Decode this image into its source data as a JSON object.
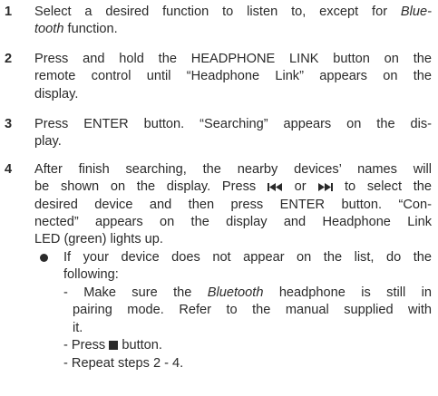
{
  "steps": [
    {
      "number": "1",
      "lines": [
        {
          "a": "Select a desired function to listen to, except for ",
          "i": "Blue-"
        },
        {
          "i": "tooth",
          "a": " function."
        }
      ]
    },
    {
      "number": "2",
      "lines": [
        "Press and hold the HEADPHONE LINK button on the",
        "remote control until “Headphone Link” appears on the",
        "display."
      ]
    },
    {
      "number": "3",
      "lines": [
        "Press ENTER button. “Searching” appears on the dis-",
        "play."
      ]
    },
    {
      "number": "4",
      "lines": [
        "After finish searching, the nearby devices’ names will",
        {
          "a": "be shown on the display. Press ",
          "or": " or ",
          "b": " to select the"
        },
        "desired device and then press ENTER button. “Con-",
        "nected” appears on the display and Headphone Link",
        "LED (green) lights up."
      ]
    }
  ],
  "bullet": {
    "lines": [
      "If your device does not appear on the list, do the",
      "following:"
    ]
  },
  "subitems": [
    {
      "lines": [
        {
          "a": "- Make sure the ",
          "i": "Bluetooth",
          "b": " headphone is still in"
        },
        "pairing mode. Refer to the manual supplied with",
        "it."
      ]
    },
    {
      "lines": [
        {
          "a": "- Press ",
          "b": " button."
        }
      ]
    },
    {
      "lines": [
        "- Repeat steps 2 - 4."
      ]
    }
  ],
  "icons": {
    "prev": "skip-previous-icon",
    "next": "skip-next-icon",
    "stop": "stop-icon"
  }
}
